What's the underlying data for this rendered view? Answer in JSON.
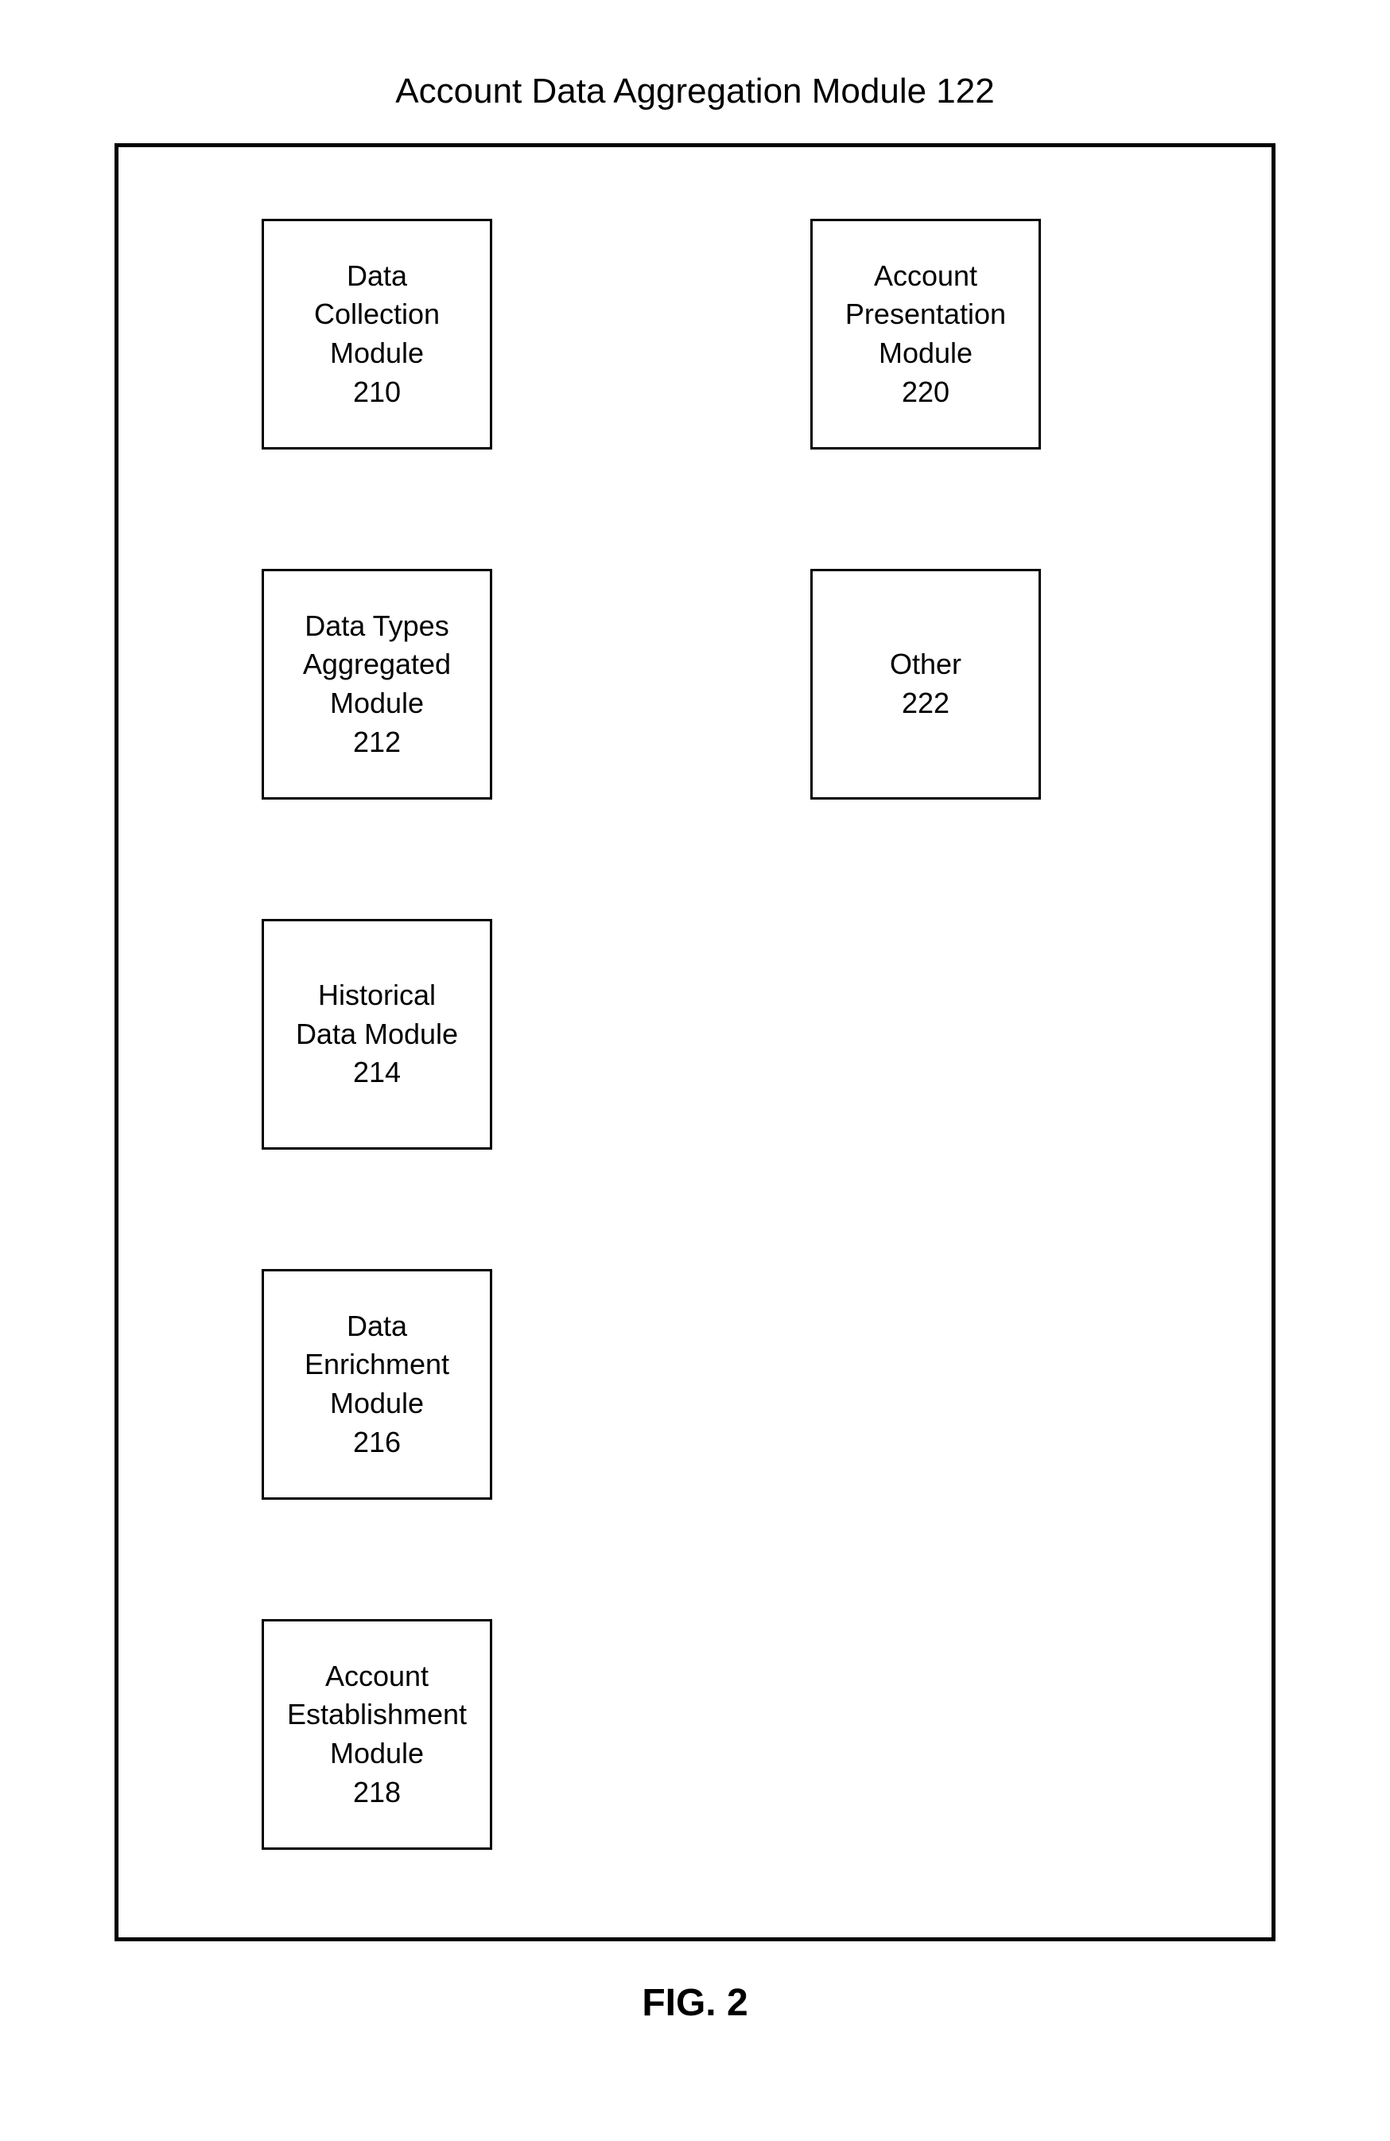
{
  "title": "Account Data Aggregation Module 122",
  "figure_label": "FIG. 2",
  "modules": {
    "box210": {
      "line1": "Data",
      "line2": "Collection",
      "line3": "Module",
      "line4": "210"
    },
    "box212": {
      "line1": "Data Types",
      "line2": "Aggregated",
      "line3": "Module",
      "line4": "212"
    },
    "box214": {
      "line1": "Historical",
      "line2": "Data Module",
      "line3": "214",
      "line4": ""
    },
    "box216": {
      "line1": "Data",
      "line2": "Enrichment",
      "line3": "Module",
      "line4": "216"
    },
    "box218": {
      "line1": "Account",
      "line2": "Establishment",
      "line3": "Module",
      "line4": "218"
    },
    "box220": {
      "line1": "Account",
      "line2": "Presentation",
      "line3": "Module",
      "line4": "220"
    },
    "box222": {
      "line1": "Other",
      "line2": "222",
      "line3": "",
      "line4": ""
    }
  }
}
